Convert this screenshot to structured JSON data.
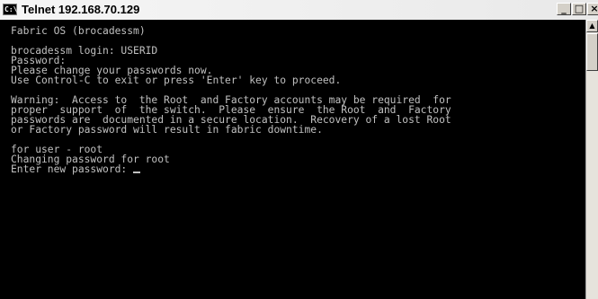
{
  "window": {
    "title": "Telnet 192.168.70.129",
    "icon": "console-icon",
    "icon_glyph": "C:\\",
    "buttons": {
      "minimize": "_",
      "maximize": "□",
      "close": "×"
    }
  },
  "terminal": {
    "lines": [
      "Fabric OS (brocadessm)",
      "",
      "brocadessm login: USERID",
      "Password:",
      "Please change your passwords now.",
      "Use Control-C to exit or press 'Enter' key to proceed.",
      "",
      "Warning:  Access to  the Root  and Factory accounts may be required  for",
      "proper  support  of  the switch.  Please  ensure  the Root  and  Factory",
      "passwords are  documented in a secure location.  Recovery of a lost Root",
      "or Factory password will result in fabric downtime.",
      "",
      "for user - root",
      "Changing password for root"
    ],
    "prompt": "Enter new password: ",
    "colors": {
      "background": "#000000",
      "foreground": "#c0c0c0"
    }
  },
  "scrollbar": {
    "up_arrow": "▲"
  }
}
